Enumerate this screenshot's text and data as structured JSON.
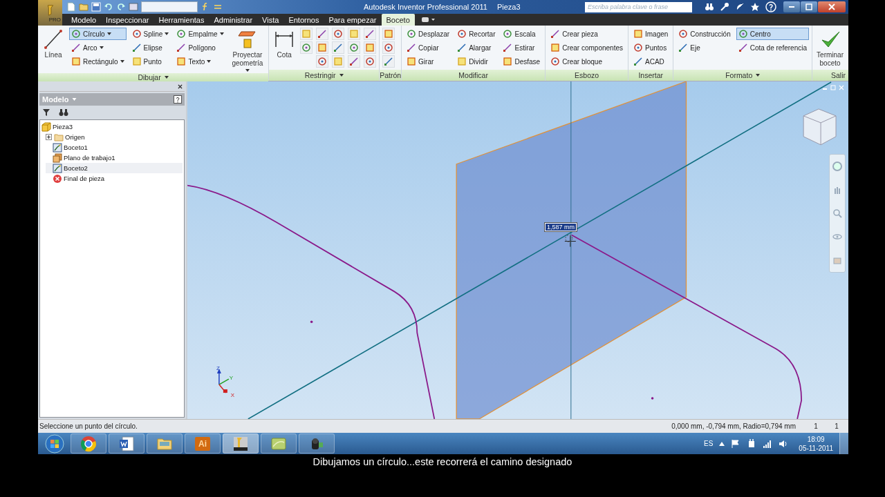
{
  "app_button": {
    "label": "PRO"
  },
  "window": {
    "title": "Autodesk Inventor Professional 2011",
    "document": "Pieza3"
  },
  "help_search": {
    "placeholder": "Escriba palabra clave o frase"
  },
  "ribbon_tabs": [
    {
      "label": "Modelo",
      "selected": false
    },
    {
      "label": "Inspeccionar",
      "selected": false
    },
    {
      "label": "Herramientas",
      "selected": false
    },
    {
      "label": "Administrar",
      "selected": false
    },
    {
      "label": "Vista",
      "selected": false
    },
    {
      "label": "Entornos",
      "selected": false
    },
    {
      "label": "Para empezar",
      "selected": false
    },
    {
      "label": "Boceto",
      "selected": true
    }
  ],
  "ribbon_panels": [
    {
      "title": "Dibujar",
      "menu": true,
      "columns": [
        [
          {
            "kind": "large",
            "label": "Línea"
          }
        ],
        [
          {
            "kind": "small",
            "label": "Círculo",
            "dropdown": true,
            "selected": true
          },
          {
            "kind": "small",
            "label": "Arco",
            "dropdown": true,
            "selected": false
          },
          {
            "kind": "small",
            "label": "Rectángulo",
            "dropdown": true,
            "selected": false
          }
        ],
        [
          {
            "kind": "small",
            "label": "Spline",
            "dropdown": true,
            "selected": false
          },
          {
            "kind": "small",
            "label": "Elipse",
            "dropdown": false,
            "selected": false
          },
          {
            "kind": "small",
            "label": "Punto",
            "dropdown": false,
            "selected": false
          }
        ],
        [
          {
            "kind": "small",
            "label": "Empalme",
            "dropdown": true,
            "selected": false
          },
          {
            "kind": "small",
            "label": "Polígono",
            "dropdown": false,
            "selected": false
          },
          {
            "kind": "small",
            "label": "Texto",
            "dropdown": true,
            "selected": false
          }
        ],
        [
          {
            "kind": "large",
            "label": "Proyectar geometría",
            "dropdown": true
          }
        ]
      ]
    },
    {
      "title": "Restringir",
      "menu": true,
      "columns": [
        [
          {
            "kind": "large",
            "label": "Cota"
          }
        ],
        [
          {
            "kind": "icon"
          },
          {
            "kind": "icon"
          }
        ],
        [
          {
            "kind": "icon"
          },
          {
            "kind": "icon"
          },
          {
            "kind": "icon"
          }
        ],
        [
          {
            "kind": "icon"
          },
          {
            "kind": "icon"
          },
          {
            "kind": "icon"
          }
        ],
        [
          {
            "kind": "icon"
          },
          {
            "kind": "icon"
          },
          {
            "kind": "icon"
          }
        ],
        [
          {
            "kind": "icon"
          },
          {
            "kind": "icon"
          },
          {
            "kind": "icon"
          }
        ]
      ]
    },
    {
      "title": "Patrón",
      "columns": [
        [
          {
            "kind": "icon"
          },
          {
            "kind": "icon"
          },
          {
            "kind": "icon"
          }
        ]
      ]
    },
    {
      "title": "Modificar",
      "columns": [
        [
          {
            "kind": "small",
            "label": "Desplazar",
            "dropdown": false,
            "selected": false
          },
          {
            "kind": "small",
            "label": "Copiar",
            "dropdown": false,
            "selected": false
          },
          {
            "kind": "small",
            "label": "Girar",
            "dropdown": false,
            "selected": false
          }
        ],
        [
          {
            "kind": "small",
            "label": "Recortar",
            "dropdown": false,
            "selected": false
          },
          {
            "kind": "small",
            "label": "Alargar",
            "dropdown": false,
            "selected": false
          },
          {
            "kind": "small",
            "label": "Dividir",
            "dropdown": false,
            "selected": false
          }
        ],
        [
          {
            "kind": "small",
            "label": "Escala",
            "dropdown": false,
            "selected": false
          },
          {
            "kind": "small",
            "label": "Estirar",
            "dropdown": false,
            "selected": false
          },
          {
            "kind": "small",
            "label": "Desfase",
            "dropdown": false,
            "selected": false
          }
        ]
      ]
    },
    {
      "title": "Esbozo",
      "columns": [
        [
          {
            "kind": "small",
            "label": "Crear pieza",
            "dropdown": false,
            "selected": false
          },
          {
            "kind": "small",
            "label": "Crear componentes",
            "dropdown": false,
            "selected": false
          },
          {
            "kind": "small",
            "label": "Crear bloque",
            "dropdown": false,
            "selected": false
          }
        ]
      ]
    },
    {
      "title": "Insertar",
      "columns": [
        [
          {
            "kind": "small",
            "label": "Imagen",
            "dropdown": false,
            "selected": false
          },
          {
            "kind": "small",
            "label": "Puntos",
            "dropdown": false,
            "selected": false
          },
          {
            "kind": "small",
            "label": "ACAD",
            "dropdown": false,
            "selected": false
          }
        ]
      ]
    },
    {
      "title": "Formato",
      "menu": true,
      "columns": [
        [
          {
            "kind": "small",
            "label": "Construcción",
            "dropdown": false,
            "selected": false
          },
          {
            "kind": "small",
            "label": "Eje",
            "dropdown": false,
            "selected": false
          }
        ],
        [
          {
            "kind": "small",
            "label": "Centro",
            "dropdown": false,
            "selected": true
          },
          {
            "kind": "small",
            "label": "Cota de referencia",
            "dropdown": false,
            "selected": false
          }
        ]
      ]
    },
    {
      "title": "Salir",
      "columns": [
        [
          {
            "kind": "large",
            "label": "Terminar boceto"
          }
        ]
      ]
    }
  ],
  "browser": {
    "title": "Modelo",
    "tree": {
      "label": "Pieza3",
      "kind": "part",
      "selected": false,
      "children": [
        {
          "label": "Origen",
          "kind": "folder",
          "expanded": false,
          "selected": false
        },
        {
          "label": "Boceto1",
          "kind": "sketch",
          "selected": false
        },
        {
          "label": "Plano de trabajo1",
          "kind": "workplane",
          "selected": false
        },
        {
          "label": "Boceto2",
          "kind": "sketch",
          "selected": true
        },
        {
          "label": "Final de pieza",
          "kind": "end",
          "selected": false
        }
      ]
    }
  },
  "viewport": {
    "dimension_value": "1,587 mm",
    "axis_labels": [
      "Z",
      "Y",
      "X"
    ]
  },
  "status_bar": {
    "prompt": "Seleccione un punto del círculo.",
    "coordinates": "0,000 mm, -0,794 mm, Radio=0,794 mm",
    "count_1": "1",
    "count_2": "1"
  },
  "taskbar": {
    "apps": [
      {
        "kind": "browser",
        "selected": false
      },
      {
        "kind": "word",
        "selected": false
      },
      {
        "kind": "folder",
        "selected": false
      },
      {
        "kind": "illustrator",
        "label": "Ai",
        "selected": false
      },
      {
        "kind": "inventor",
        "selected": true
      },
      {
        "kind": "notes",
        "selected": false
      },
      {
        "kind": "camera",
        "selected": false
      }
    ],
    "language": "ES",
    "time": "18:09",
    "date": "05-11-2011"
  },
  "caption": "Dibujamos un círculo...este recorrerá el camino designado"
}
